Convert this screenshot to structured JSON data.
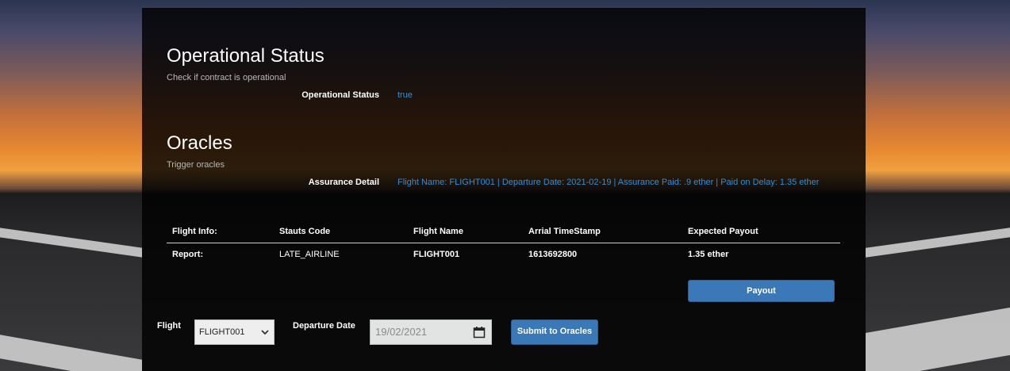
{
  "operational": {
    "title": "Operational Status",
    "subtitle": "Check if contract is operational",
    "status_label": "Operational Status",
    "status_value": "true"
  },
  "oracles": {
    "title": "Oracles",
    "subtitle": "Trigger oracles",
    "assurance_label": "Assurance Detail",
    "assurance_value": "Flight Name: FLIGHT001 | Departure Date: 2021-02-19 | Assurance Paid: .9 ether | Paid on Delay: 1.35 ether"
  },
  "report_table": {
    "headers": [
      "Flight Info:",
      "Stauts Code",
      "Flight Name",
      "Arrial TimeStamp",
      "Expected Payout"
    ],
    "row": [
      "Report:",
      "LATE_AIRLINE",
      "FLIGHT001",
      "1613692800",
      "1.35 ether"
    ]
  },
  "payout_button": "Payout",
  "form": {
    "flight_label": "Flight",
    "flight_selected": "FLIGHT001",
    "date_label": "Departure Date",
    "date_value": "19/02/2021",
    "submit_label": "Submit to Oracles"
  },
  "colors": {
    "accent": "#3b78b8",
    "link_text": "#2f8fd8",
    "panel": "#000000"
  },
  "icons": [
    "chevron-down-icon",
    "calendar-icon"
  ]
}
